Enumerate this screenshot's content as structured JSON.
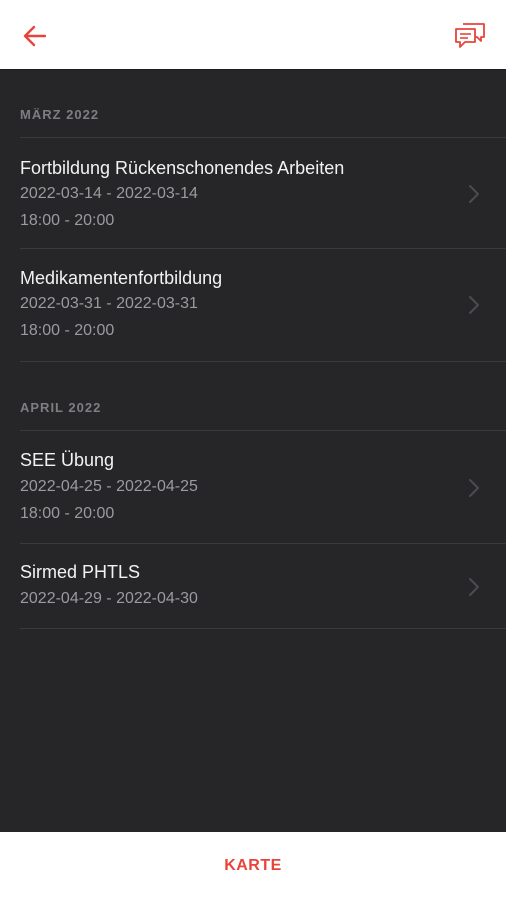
{
  "header": {
    "title": "",
    "back_icon": "arrow-left-icon",
    "chat_icon": "chat-bubbles-icon",
    "accent": "#e8443a"
  },
  "sections": [
    {
      "header": "MÄRZ 2022",
      "events": [
        {
          "title": "Fortbildung Rückenschonendes Arbeiten",
          "dates": "2022-03-14 - 2022-03-14",
          "time": "18:00 - 20:00"
        },
        {
          "title": "Medikamentenfortbildung",
          "dates": "2022-03-31 - 2022-03-31",
          "time": "18:00 - 20:00"
        }
      ]
    },
    {
      "header": "APRIL 2022",
      "events": [
        {
          "title": "SEE Übung",
          "dates": "2022-04-25 - 2022-04-25",
          "time": "18:00 - 20:00"
        },
        {
          "title": "Sirmed PHTLS",
          "dates": "2022-04-29 - 2022-04-30"
        }
      ]
    }
  ],
  "footer": {
    "karte_label": "KARTE"
  }
}
